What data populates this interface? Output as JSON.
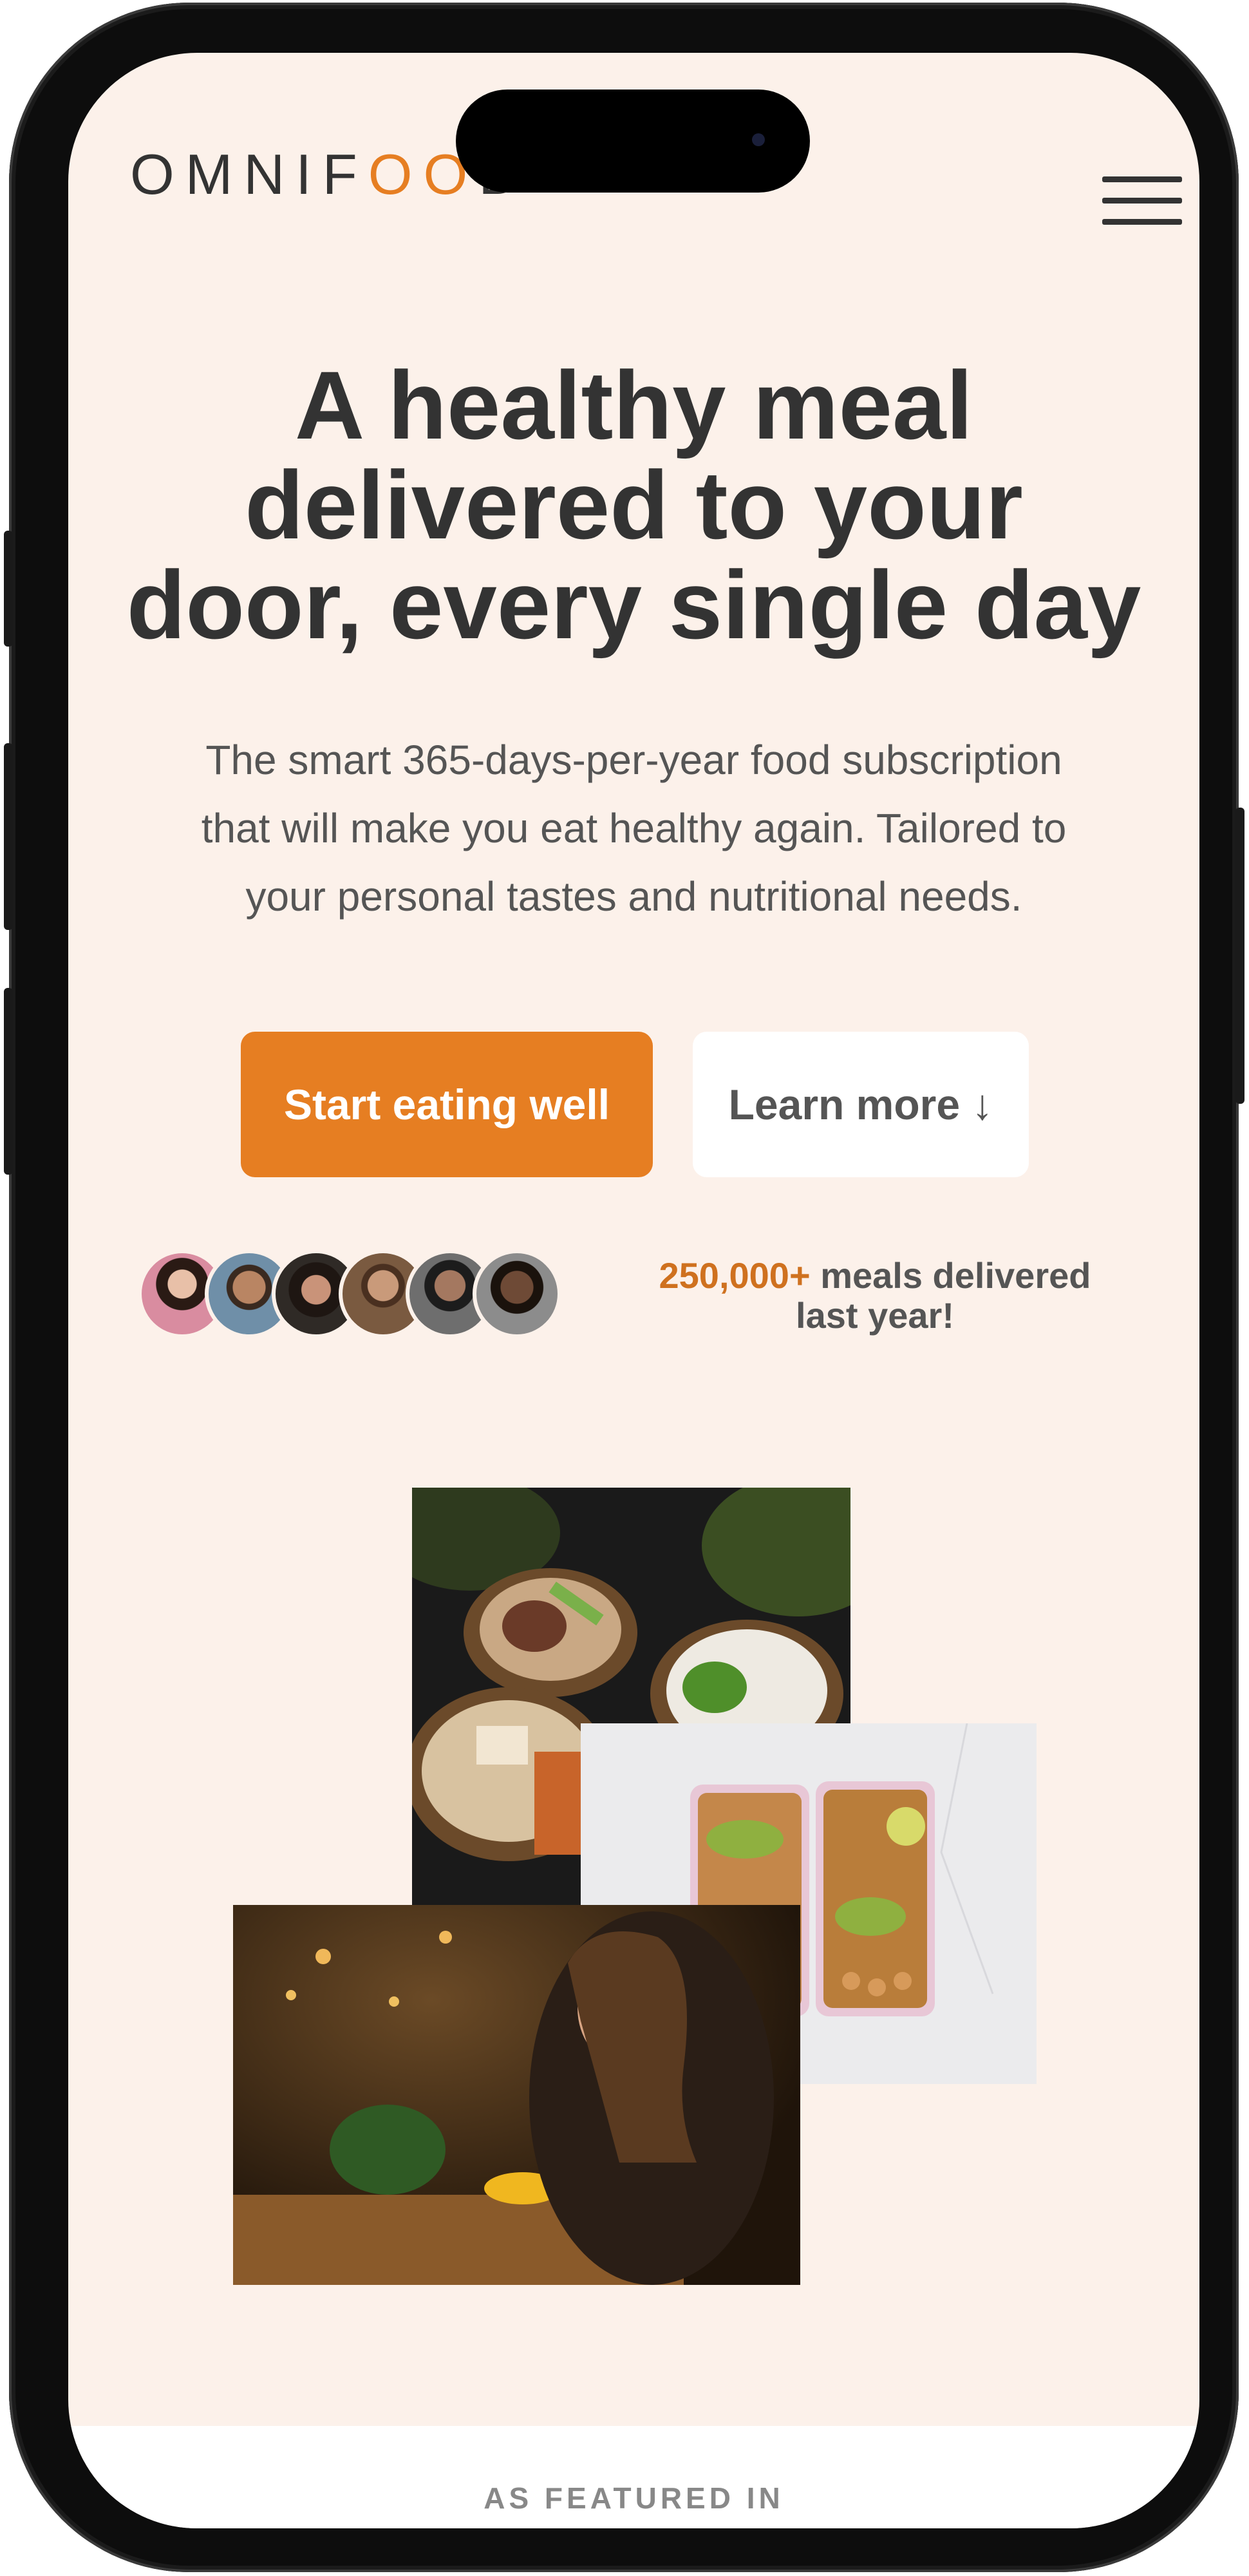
{
  "header": {
    "logo_text": "OMNIFOOD",
    "menu_icon": "hamburger-menu-icon"
  },
  "hero": {
    "headline_lines": [
      "A healthy meal",
      "delivered to your",
      "door, every single day"
    ],
    "description_lines": [
      "The smart 365-days-per-year food subscription",
      "that will make you eat healthy again. Tailored to",
      "your personal tastes and nutritional needs."
    ],
    "primary_button": "Start eating well",
    "secondary_button": "Learn more ↓",
    "stat_highlight": "250,000+",
    "stat_text_1": " meals delivered",
    "stat_text_2": "last year!"
  },
  "customers": {
    "count": 6
  },
  "images": {
    "photo_1": "bowls-of-meals-photo",
    "photo_2": "meal-prep-boxes-photo",
    "photo_3": "woman-dining-photo"
  },
  "featured": {
    "label": "AS FEATURED IN"
  },
  "colors": {
    "accent": "#e67e22",
    "accent_text": "#cf711f",
    "background": "#fcf1ea",
    "text_dark": "#333333",
    "text_medium": "#555555"
  }
}
